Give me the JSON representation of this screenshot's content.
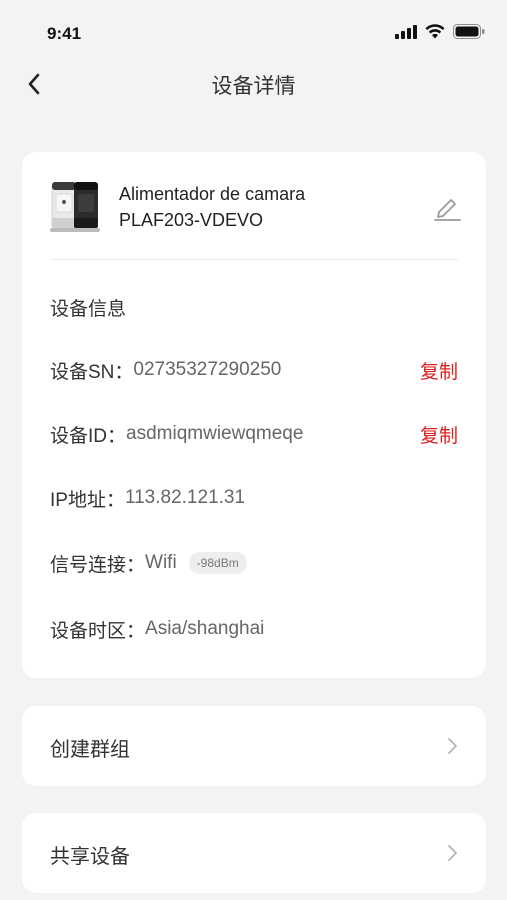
{
  "status_bar": {
    "time": "9:41"
  },
  "nav": {
    "title": "设备详情"
  },
  "device": {
    "name_line1": "Alimentador de camara",
    "name_line2": "PLAF203-VDEVO"
  },
  "info": {
    "section_title": "设备信息",
    "sn_label": "设备SN：",
    "sn_value": "02735327290250",
    "id_label": "设备ID：",
    "id_value": "asdmiqmwiewqmeqe",
    "ip_label": "IP地址：",
    "ip_value": "113.82.121.31",
    "signal_label": "信号连接：",
    "signal_value": "Wifi",
    "signal_strength": "-98dBm",
    "timezone_label": "设备时区：",
    "timezone_value": "Asia/shanghai",
    "copy_label": "复制"
  },
  "menu": {
    "create_group": "创建群组",
    "share_device": "共享设备"
  },
  "colors": {
    "accent_red": "#e0201e",
    "background": "#f2f3f5",
    "card": "#ffffff"
  },
  "icons": {
    "back": "chevron-left-icon",
    "edit": "pencil-icon",
    "chevron": "chevron-right-icon",
    "signal": "cellular-signal-icon",
    "wifi": "wifi-icon",
    "battery": "battery-icon"
  }
}
